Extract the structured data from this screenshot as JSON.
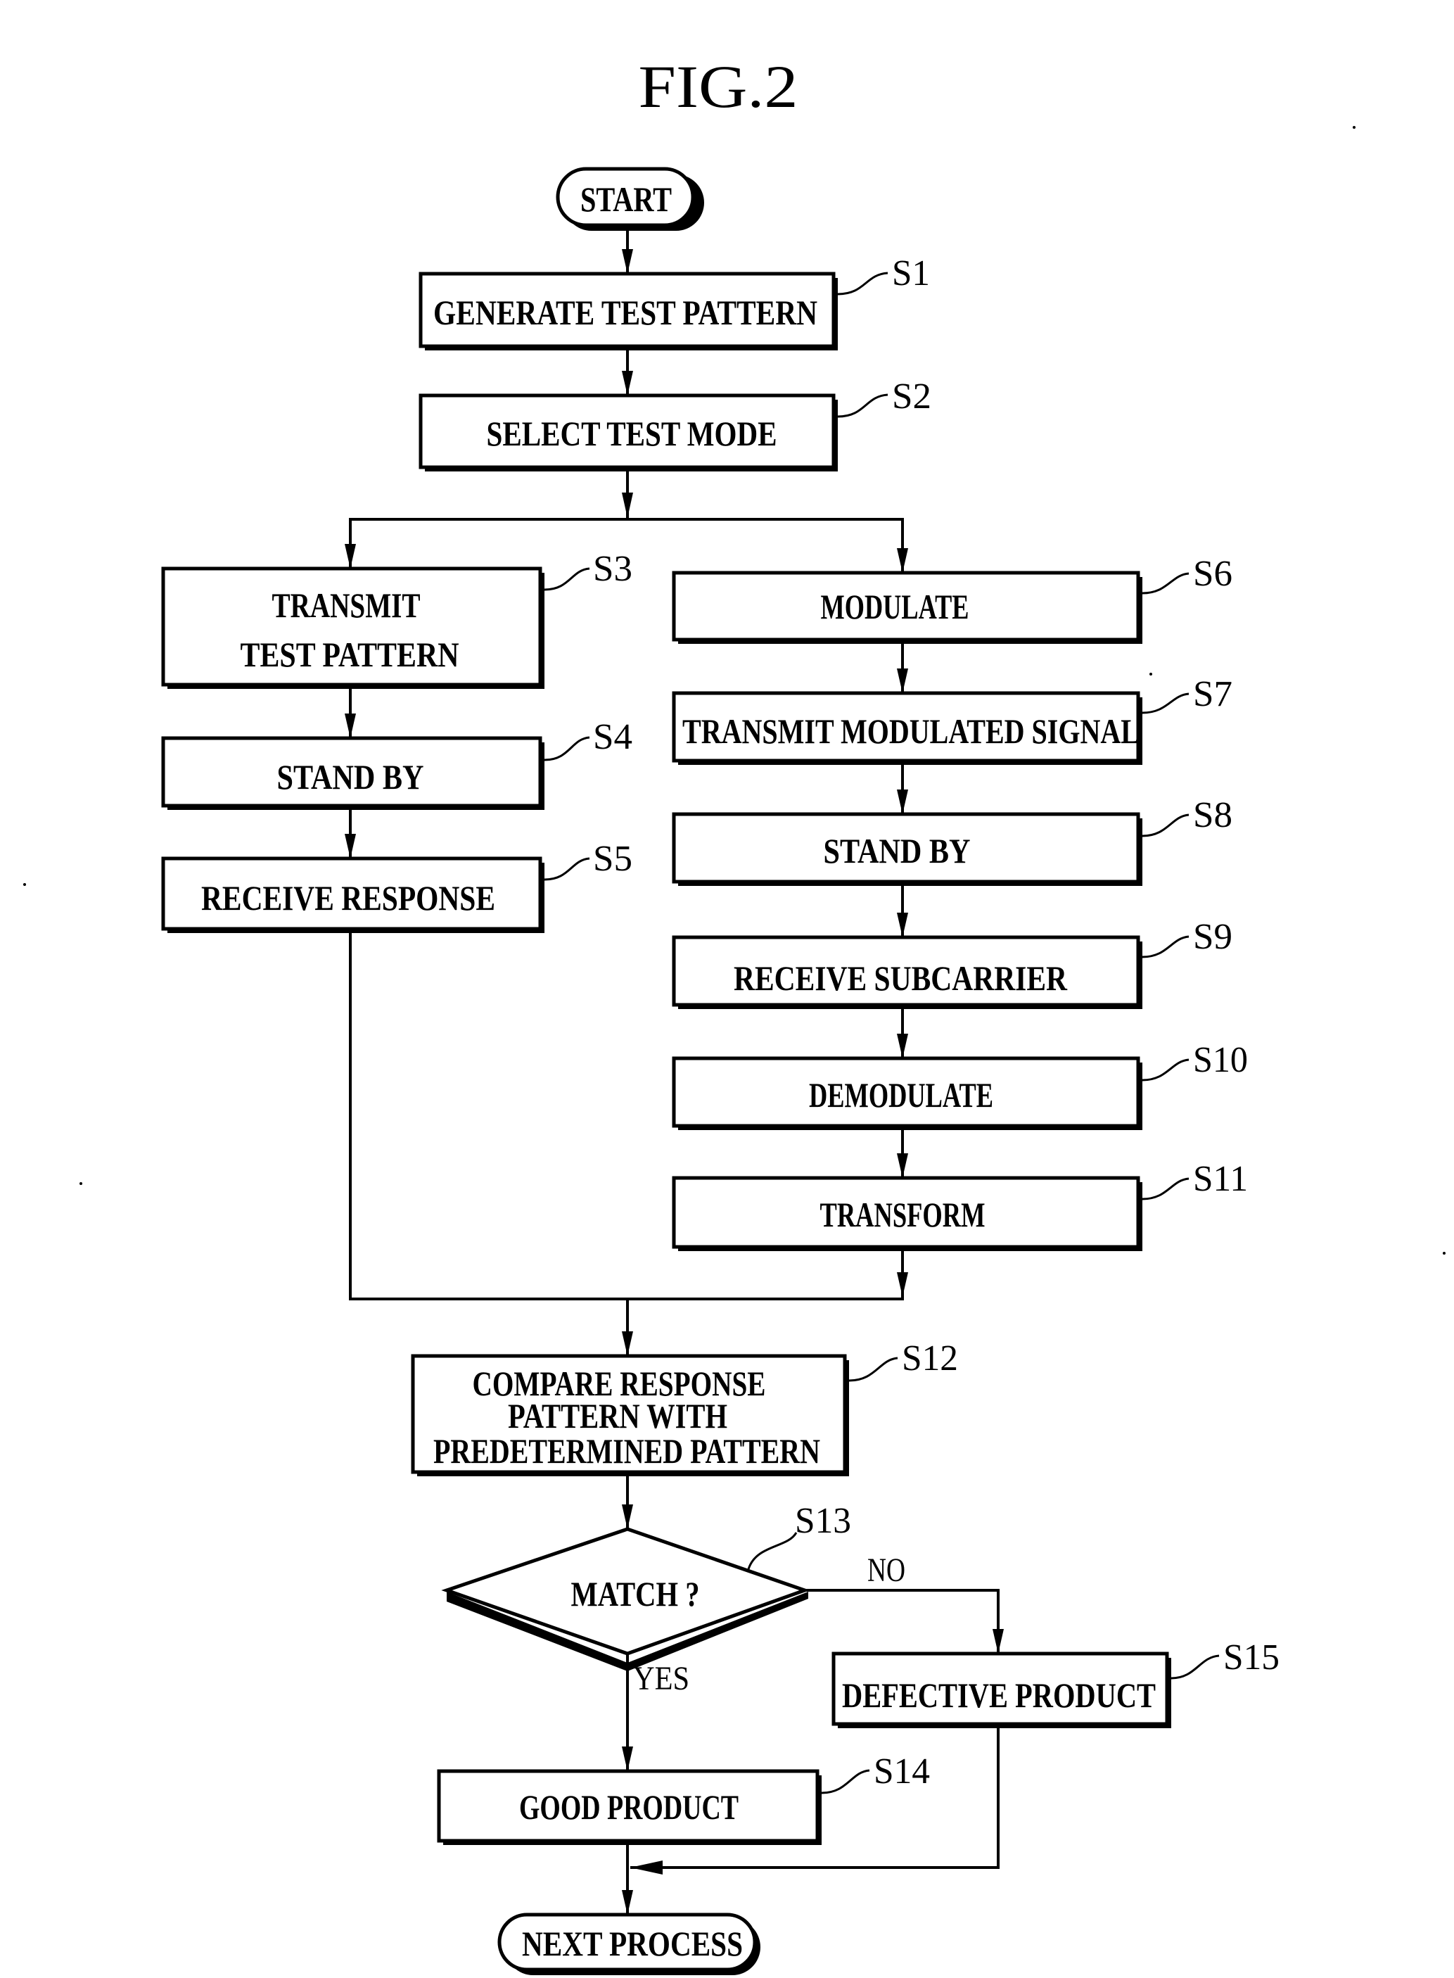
{
  "figure": {
    "title": "FIG.2",
    "background_color": "#ffffff",
    "ink_color": "#000000"
  },
  "terminals": {
    "start": "START",
    "end": "NEXT PROCESS"
  },
  "steps": {
    "s1": {
      "id": "S1",
      "lines": [
        "GENERATE TEST PATTERN"
      ]
    },
    "s2": {
      "id": "S2",
      "lines": [
        "SELECT TEST MODE"
      ]
    },
    "s3": {
      "id": "S3",
      "lines": [
        "TRANSMIT",
        "TEST PATTERN"
      ]
    },
    "s4": {
      "id": "S4",
      "lines": [
        "STAND BY"
      ]
    },
    "s5": {
      "id": "S5",
      "lines": [
        "RECEIVE RESPONSE"
      ]
    },
    "s6": {
      "id": "S6",
      "lines": [
        "MODULATE"
      ]
    },
    "s7": {
      "id": "S7",
      "lines": [
        "TRANSMIT MODULATED SIGNAL"
      ]
    },
    "s8": {
      "id": "S8",
      "lines": [
        "STAND BY"
      ]
    },
    "s9": {
      "id": "S9",
      "lines": [
        "RECEIVE SUBCARRIER"
      ]
    },
    "s10": {
      "id": "S10",
      "lines": [
        "DEMODULATE"
      ]
    },
    "s11": {
      "id": "S11",
      "lines": [
        "TRANSFORM"
      ]
    },
    "s12": {
      "id": "S12",
      "lines": [
        "COMPARE RESPONSE",
        "PATTERN WITH",
        "PREDETERMINED PATTERN"
      ]
    },
    "s13": {
      "id": "S13",
      "lines": [
        "MATCH ?"
      ]
    },
    "s14": {
      "id": "S14",
      "lines": [
        "GOOD PRODUCT"
      ]
    },
    "s15": {
      "id": "S15",
      "lines": [
        "DEFECTIVE PRODUCT"
      ]
    }
  },
  "branches": {
    "yes": "YES",
    "no": "NO"
  }
}
